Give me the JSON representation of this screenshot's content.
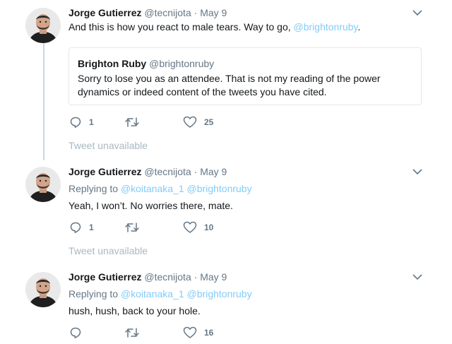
{
  "tweets": [
    {
      "name": "Jorge Gutierrez",
      "handle": "@tecnijota",
      "separator": "·",
      "time": "May 9",
      "text": "And this is how you react to male tears. Way to go, ",
      "mention": "@brightonruby",
      "text_end": ".",
      "quote": {
        "name": "Brighton Ruby",
        "handle": "@brightonruby",
        "text": "Sorry to lose you as an attendee. That is not my reading of the power dynamics or indeed content of the tweets you have cited."
      },
      "replies": "1",
      "retweets": "",
      "likes": "25"
    },
    {
      "name": "Jorge Gutierrez",
      "handle": "@tecnijota",
      "separator": "·",
      "time": "May 9",
      "replying_label": "Replying to",
      "reply_to_1": "@koitanaka_1",
      "reply_to_2": "@brightonruby",
      "text": "Yeah, I won’t. No worries there, mate.",
      "replies": "1",
      "retweets": "",
      "likes": "10"
    },
    {
      "name": "Jorge Gutierrez",
      "handle": "@tecnijota",
      "separator": "·",
      "time": "May 9",
      "replying_label": "Replying to",
      "reply_to_1": "@koitanaka_1",
      "reply_to_2": "@brightonruby",
      "text": "hush, hush, back to your hole.",
      "replies": "",
      "retweets": "",
      "likes": "16"
    }
  ],
  "unavailable_1": "Tweet unavailable",
  "unavailable_2": "Tweet unavailable",
  "colors": {
    "link": "#1da1f2",
    "muted": "#657786",
    "border": "#e1e8ed",
    "thread_line": "#ccd6dd"
  }
}
